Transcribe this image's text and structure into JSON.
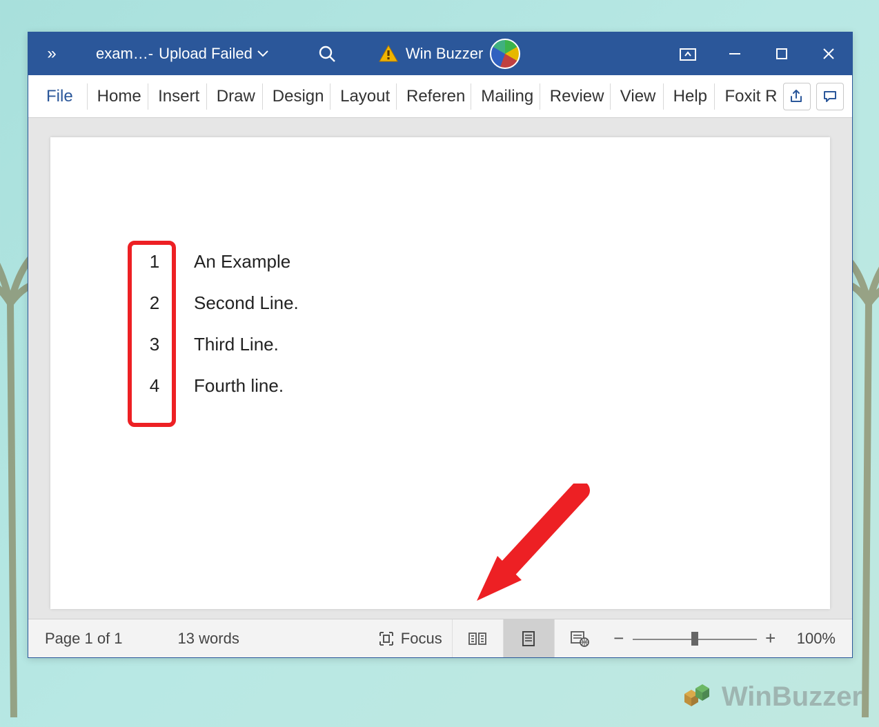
{
  "title": {
    "overflow_label": "»",
    "file_name": "exam…",
    "separator": " - ",
    "status": "Upload Failed",
    "user_name": "Win Buzzer"
  },
  "ribbon": {
    "file": "File",
    "tabs": [
      "Home",
      "Insert",
      "Draw",
      "Design",
      "Layout",
      "Referen",
      "Mailing",
      "Review",
      "View",
      "Help",
      "Foxit R"
    ]
  },
  "document": {
    "lines": [
      {
        "num": "1",
        "text": "An Example"
      },
      {
        "num": "2",
        "text": "Second Line."
      },
      {
        "num": "3",
        "text": "Third Line."
      },
      {
        "num": "4",
        "text": "Fourth line."
      }
    ]
  },
  "status": {
    "page": "Page 1 of 1",
    "words": "13 words",
    "focus": "Focus",
    "zoom_pct": "100%"
  },
  "watermark": "WinBuzzer",
  "highlight_color": "#ed2024",
  "brand_color": "#2b579a"
}
